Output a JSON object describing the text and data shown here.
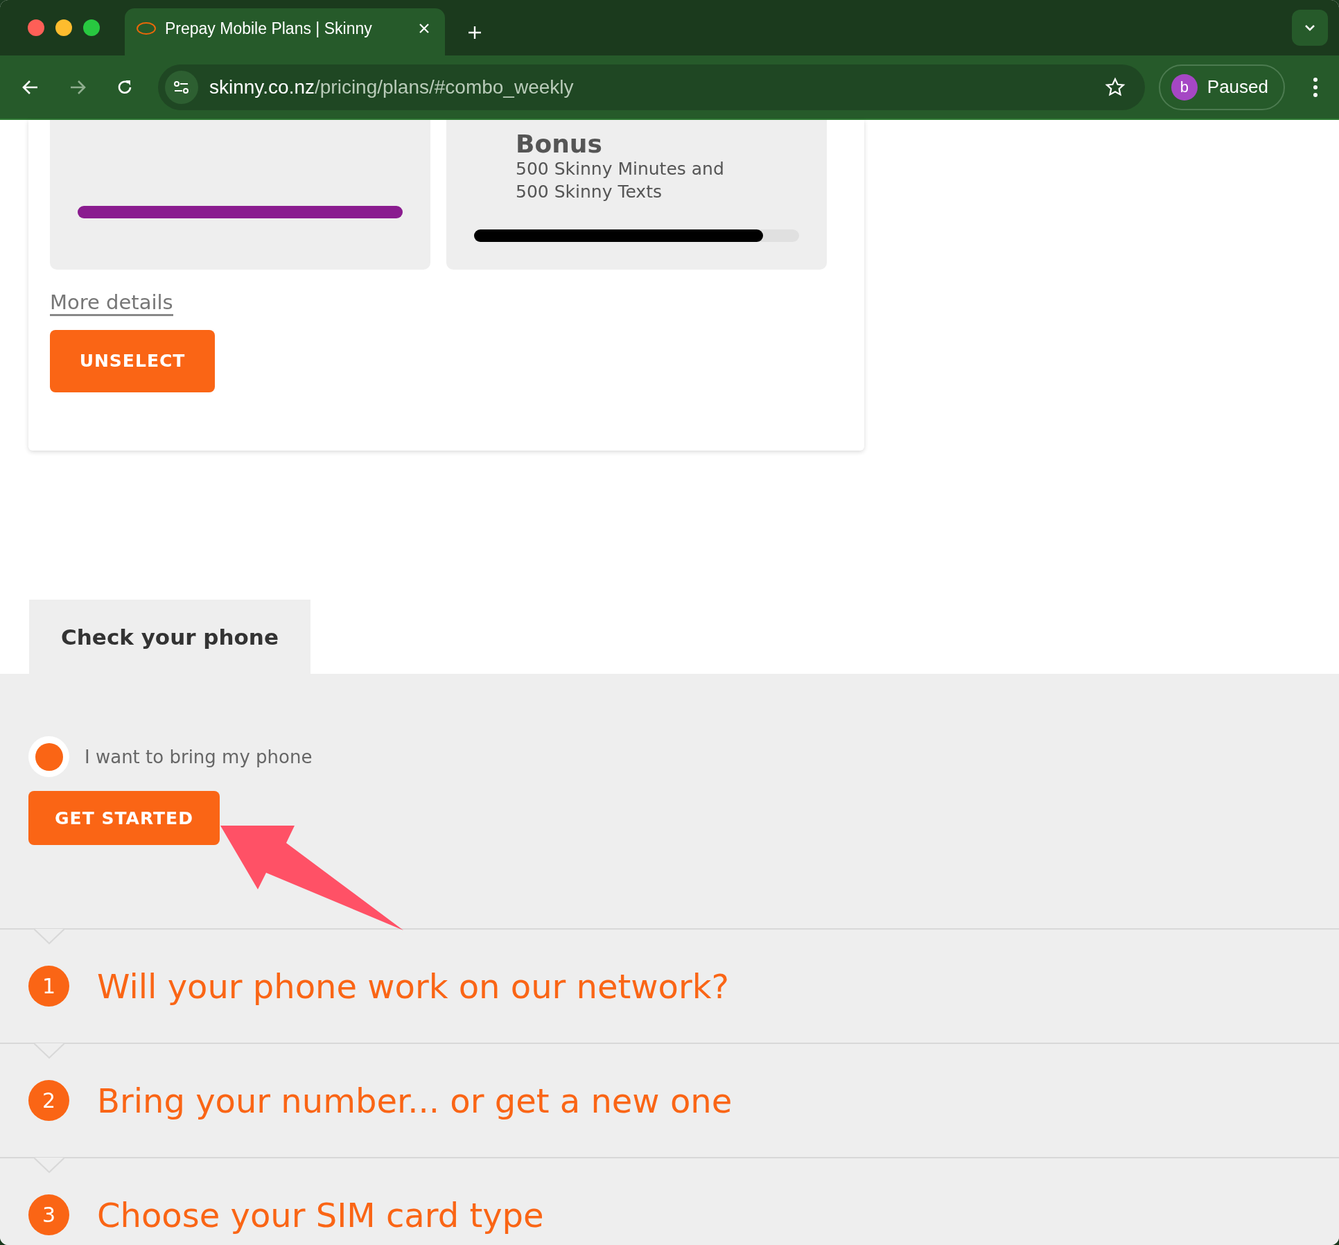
{
  "browser": {
    "tab_title": "Prepay Mobile Plans | Skinny",
    "url_host": "skinny.co.nz",
    "url_path": "/pricing/plans/#combo_weekly",
    "profile_initial": "b",
    "profile_status": "Paused"
  },
  "plan_card": {
    "tiles": [
      {
        "color": "#8a1c8f"
      },
      {
        "title": "Bonus",
        "text": "500 Skinny Minutes and\n500 Skinny Texts",
        "level": 0.89,
        "color": "#000000"
      }
    ],
    "details_link": "More details",
    "button": "UNSELECT"
  },
  "check_phone": {
    "tab": "Check your phone",
    "option": {
      "label": "I want to bring my phone",
      "selected": true
    },
    "button": "GET STARTED"
  },
  "steps": [
    {
      "number": "1",
      "title": "Will your phone work on our network?"
    },
    {
      "number": "2",
      "title": "Bring your number... or get a new one"
    },
    {
      "number": "3",
      "title": "Choose your SIM card type"
    }
  ]
}
